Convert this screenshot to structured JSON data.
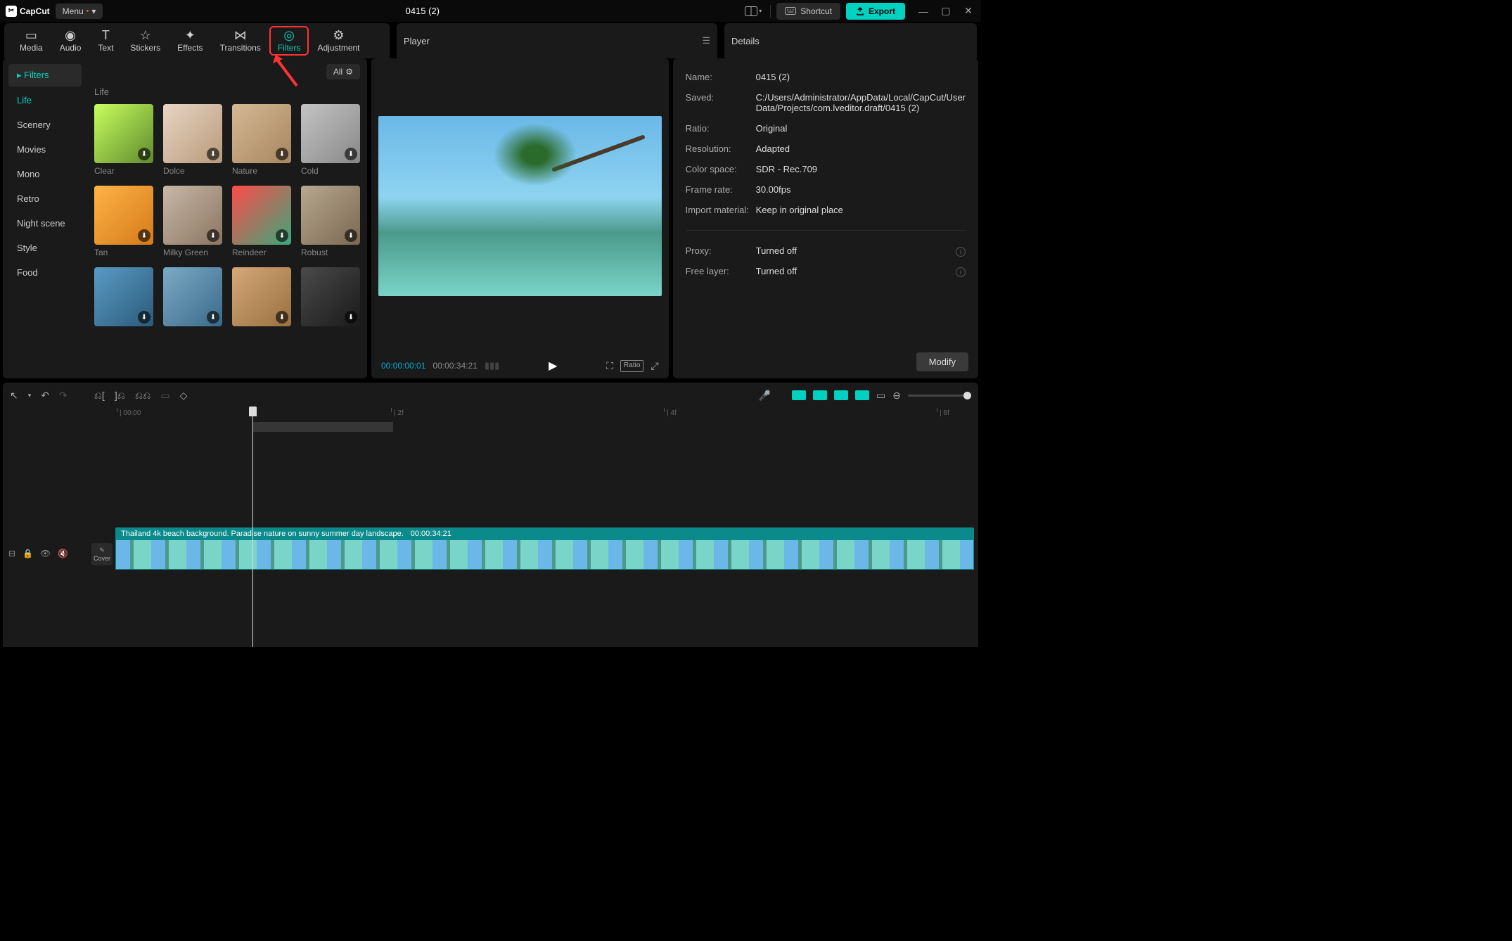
{
  "app_name": "CapCut",
  "menu_label": "Menu",
  "project_title": "0415 (2)",
  "shortcut_label": "Shortcut",
  "export_label": "Export",
  "tabs": [
    "Media",
    "Audio",
    "Text",
    "Stickers",
    "Effects",
    "Transitions",
    "Filters",
    "Adjustment"
  ],
  "active_tab": "Filters",
  "sidebar_header": "Filters",
  "categories": [
    "Life",
    "Scenery",
    "Movies",
    "Mono",
    "Retro",
    "Night scene",
    "Style",
    "Food"
  ],
  "active_category": "Life",
  "all_label": "All",
  "section_label": "Life",
  "filters": [
    "Clear",
    "Dolce",
    "Nature",
    "Cold",
    "Tan",
    "Milky Green",
    "Reindeer",
    "Robust",
    "",
    "",
    "",
    ""
  ],
  "player_title": "Player",
  "time_current": "00:00:00:01",
  "time_duration": "00:00:34:21",
  "ratio_label": "Ratio",
  "details_title": "Details",
  "details": {
    "name_label": "Name:",
    "name": "0415 (2)",
    "saved_label": "Saved:",
    "saved": "C:/Users/Administrator/AppData/Local/CapCut/User Data/Projects/com.lveditor.draft/0415 (2)",
    "ratio_label": "Ratio:",
    "ratio": "Original",
    "resolution_label": "Resolution:",
    "resolution": "Adapted",
    "colorspace_label": "Color space:",
    "colorspace": "SDR - Rec.709",
    "framerate_label": "Frame rate:",
    "framerate": "30.00fps",
    "import_label": "Import material:",
    "import": "Keep in original place",
    "proxy_label": "Proxy:",
    "proxy": "Turned off",
    "freelayer_label": "Free layer:",
    "freelayer": "Turned off"
  },
  "modify_label": "Modify",
  "cover_label": "Cover",
  "ruler_marks": [
    {
      "pos": 6,
      "label": "00:00"
    },
    {
      "pos": 396,
      "label": "2f"
    },
    {
      "pos": 784,
      "label": "4f"
    },
    {
      "pos": 1172,
      "label": "6f"
    }
  ],
  "clip": {
    "title": "Thailand 4k beach background. Paradise nature on sunny summer day landscape.",
    "duration": "00:00:34:21"
  }
}
